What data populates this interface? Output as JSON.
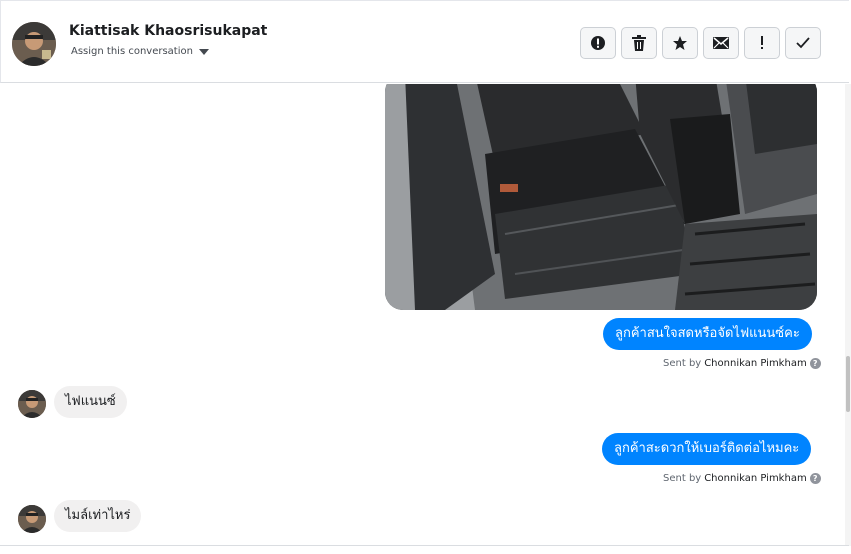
{
  "header": {
    "contact_name": "Kiattisak Khaosrisukapat",
    "assign_label": "Assign this conversation",
    "actions": [
      {
        "name": "spam-button",
        "icon": "exclamation-circle-icon"
      },
      {
        "name": "delete-button",
        "icon": "trash-icon"
      },
      {
        "name": "star-button",
        "icon": "star-icon"
      },
      {
        "name": "mark-unread-button",
        "icon": "envelope-icon"
      },
      {
        "name": "follow-up-button",
        "icon": "exclamation-icon"
      },
      {
        "name": "mark-done-button",
        "icon": "checkmark-icon"
      }
    ]
  },
  "messages": {
    "m1": {
      "text": "ลูกค้าสนใจสดหรือจัดไฟแนนซ์คะ",
      "sent_by_prefix": "Sent by",
      "sent_by_name": "Chonnikan Pimkham"
    },
    "m2": {
      "text": "ไฟแนนซ์"
    },
    "m3": {
      "text": "ลูกค้าสะดวกให้เบอร์ติดต่อไหมคะ",
      "sent_by_prefix": "Sent by",
      "sent_by_name": "Chonnikan Pimkham"
    },
    "m4": {
      "text": "ไมล์เท่าไหร่"
    }
  },
  "help_glyph": "?",
  "colors": {
    "outgoing": "#0084ff",
    "incoming": "#f1f0f0",
    "text": "#1c1e21"
  }
}
